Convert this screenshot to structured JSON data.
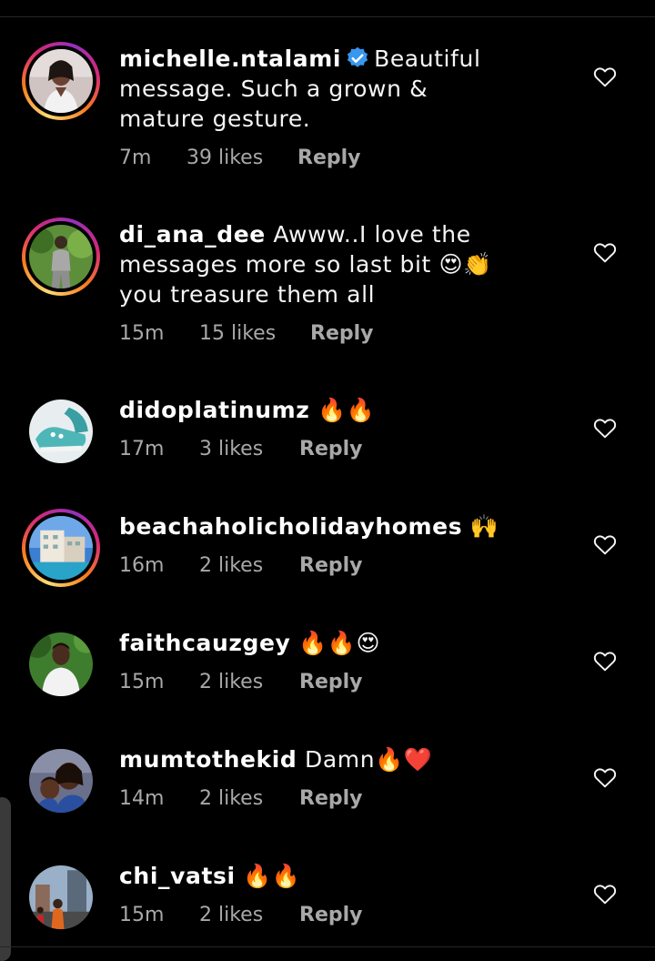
{
  "comments": [
    {
      "username": "michelle.ntalami",
      "verified": true,
      "text": "Beautiful message. Such a grown & mature gesture.",
      "time": "7m",
      "likes": "39 likes",
      "reply": "Reply",
      "avatar_icon": "profile-photo-woman",
      "story_ring": true
    },
    {
      "username": "di_ana_dee",
      "verified": false,
      "text": "Awww..I love the messages more so last bit 😍👏you treasure them all",
      "time": "15m",
      "likes": "15 likes",
      "reply": "Reply",
      "avatar_icon": "profile-photo-woman-outdoors",
      "story_ring": true
    },
    {
      "username": "didoplatinumz",
      "verified": false,
      "text": "🔥🔥",
      "time": "17m",
      "likes": "3 likes",
      "reply": "Reply",
      "avatar_icon": "profile-photo-sneakers",
      "story_ring": false
    },
    {
      "username": "beachaholicholidayhomes",
      "verified": false,
      "text": "🙌",
      "time": "16m",
      "likes": "2 likes",
      "reply": "Reply",
      "avatar_icon": "profile-photo-building",
      "story_ring": true
    },
    {
      "username": "faithcauzgey",
      "verified": false,
      "text": "🔥🔥😍",
      "time": "15m",
      "likes": "2 likes",
      "reply": "Reply",
      "avatar_icon": "profile-photo-person",
      "story_ring": false
    },
    {
      "username": "mumtothekid",
      "verified": false,
      "text": "Damn🔥❤️",
      "time": "14m",
      "likes": "2 likes",
      "reply": "Reply",
      "avatar_icon": "profile-photo-mother-child",
      "story_ring": false
    },
    {
      "username": "chi_vatsi",
      "verified": false,
      "text": "🔥🔥",
      "time": "15m",
      "likes": "2 likes",
      "reply": "Reply",
      "avatar_icon": "profile-photo-street",
      "story_ring": false
    }
  ],
  "colors": {
    "background": "#000000",
    "text": "#f5f5f5",
    "meta": "#a8a8a8",
    "verified": "#3897f0"
  }
}
